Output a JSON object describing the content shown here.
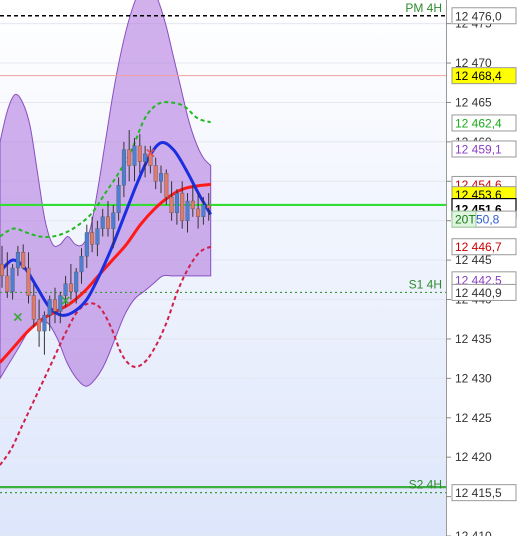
{
  "chart_data": {
    "type": "candlestick",
    "title": "",
    "instrument_timeframe": "",
    "ylim": [
      12410,
      12478
    ],
    "y_ticks": [
      12410,
      12415,
      12420,
      12425,
      12430,
      12435,
      12440,
      12445,
      12450,
      12455,
      12460,
      12465,
      12470,
      12475
    ],
    "y_tick_labels": [
      "12 410",
      "12 415",
      "12 420",
      "12 425",
      "12 430",
      "12 435",
      "12 440",
      "12 445",
      "12 450",
      "12 455",
      "12 460",
      "12 465",
      "12 470",
      "12 475"
    ],
    "candles": [
      {
        "o": 12444.5,
        "h": 12446.8,
        "l": 12441.5,
        "c": 12443.0
      },
      {
        "o": 12443.0,
        "h": 12446.0,
        "l": 12440.2,
        "c": 12441.0
      },
      {
        "o": 12441.0,
        "h": 12444.5,
        "l": 12440.0,
        "c": 12444.0
      },
      {
        "o": 12444.0,
        "h": 12446.8,
        "l": 12443.0,
        "c": 12446.0
      },
      {
        "o": 12446.0,
        "h": 12447.0,
        "l": 12443.8,
        "c": 12444.0
      },
      {
        "o": 12444.0,
        "h": 12446.0,
        "l": 12439.5,
        "c": 12440.5
      },
      {
        "o": 12440.5,
        "h": 12442.0,
        "l": 12436.5,
        "c": 12437.5
      },
      {
        "o": 12437.5,
        "h": 12440.0,
        "l": 12434.0,
        "c": 12436.0
      },
      {
        "o": 12436.0,
        "h": 12438.5,
        "l": 12433.0,
        "c": 12438.0
      },
      {
        "o": 12438.0,
        "h": 12440.5,
        "l": 12436.0,
        "c": 12440.0
      },
      {
        "o": 12440.0,
        "h": 12441.5,
        "l": 12437.0,
        "c": 12438.5
      },
      {
        "o": 12438.5,
        "h": 12441.0,
        "l": 12437.0,
        "c": 12440.5
      },
      {
        "o": 12440.5,
        "h": 12443.0,
        "l": 12439.0,
        "c": 12442.0
      },
      {
        "o": 12442.0,
        "h": 12444.5,
        "l": 12440.0,
        "c": 12441.0
      },
      {
        "o": 12441.0,
        "h": 12444.0,
        "l": 12439.5,
        "c": 12443.5
      },
      {
        "o": 12443.5,
        "h": 12446.5,
        "l": 12442.0,
        "c": 12445.5
      },
      {
        "o": 12445.5,
        "h": 12449.5,
        "l": 12444.0,
        "c": 12448.5
      },
      {
        "o": 12448.5,
        "h": 12450.5,
        "l": 12446.0,
        "c": 12447.0
      },
      {
        "o": 12447.0,
        "h": 12450.0,
        "l": 12445.5,
        "c": 12449.0
      },
      {
        "o": 12449.0,
        "h": 12451.5,
        "l": 12448.0,
        "c": 12450.5
      },
      {
        "o": 12450.5,
        "h": 12452.5,
        "l": 12448.0,
        "c": 12449.0
      },
      {
        "o": 12449.0,
        "h": 12452.0,
        "l": 12446.5,
        "c": 12451.0
      },
      {
        "o": 12451.0,
        "h": 12455.5,
        "l": 12450.0,
        "c": 12454.5
      },
      {
        "o": 12454.5,
        "h": 12460.0,
        "l": 12453.0,
        "c": 12459.0
      },
      {
        "o": 12459.0,
        "h": 12461.5,
        "l": 12455.0,
        "c": 12457.0
      },
      {
        "o": 12457.0,
        "h": 12460.5,
        "l": 12455.0,
        "c": 12459.5
      },
      {
        "o": 12459.5,
        "h": 12461.0,
        "l": 12456.0,
        "c": 12457.5
      },
      {
        "o": 12457.5,
        "h": 12459.5,
        "l": 12455.5,
        "c": 12458.5
      },
      {
        "o": 12458.5,
        "h": 12459.5,
        "l": 12456.0,
        "c": 12457.0
      },
      {
        "o": 12457.0,
        "h": 12458.0,
        "l": 12454.0,
        "c": 12455.0
      },
      {
        "o": 12455.0,
        "h": 12457.0,
        "l": 12453.5,
        "c": 12456.0
      },
      {
        "o": 12456.0,
        "h": 12456.5,
        "l": 12452.0,
        "c": 12453.0
      },
      {
        "o": 12453.0,
        "h": 12455.0,
        "l": 12450.0,
        "c": 12451.0
      },
      {
        "o": 12451.0,
        "h": 12454.0,
        "l": 12449.5,
        "c": 12453.5
      },
      {
        "o": 12453.5,
        "h": 12455.0,
        "l": 12449.0,
        "c": 12450.0
      },
      {
        "o": 12450.0,
        "h": 12453.5,
        "l": 12448.5,
        "c": 12452.5
      },
      {
        "o": 12452.5,
        "h": 12454.5,
        "l": 12450.5,
        "c": 12451.5
      },
      {
        "o": 12451.5,
        "h": 12453.5,
        "l": 12449.0,
        "c": 12450.5
      },
      {
        "o": 12450.5,
        "h": 12453.0,
        "l": 12449.5,
        "c": 12452.0
      },
      {
        "o": 12452.0,
        "h": 12453.5,
        "l": 12450.0,
        "c": 12451.6
      }
    ],
    "candle_colors": {
      "up": "#4a7fd4",
      "down": "#e07a6a",
      "wick": "#333333"
    },
    "bollinger_fill": "#b57fe0",
    "bollinger_upper": [
      12460,
      12464,
      12466,
      12465,
      12462,
      12456,
      12450,
      12447,
      12447,
      12448,
      12447,
      12447,
      12449,
      12454,
      12460,
      12466,
      12471,
      12475,
      12478,
      12480,
      12480,
      12478,
      12475,
      12471,
      12467,
      12463,
      12460,
      12458,
      12457
    ],
    "bollinger_lower": [
      12430,
      12432,
      12434,
      12436,
      12437,
      12437,
      12435,
      12432,
      12430,
      12429,
      12430,
      12432,
      12435,
      12438,
      12440,
      12441,
      12442,
      12443,
      12443,
      12443,
      12443,
      12443,
      12443
    ],
    "blue_ma": [
      12443.5,
      12445,
      12444,
      12441.5,
      12439,
      12438,
      12438.5,
      12440,
      12443,
      12446.5,
      12450.5,
      12454.5,
      12458,
      12459.9,
      12459,
      12456.5,
      12453.5,
      12450.8
    ],
    "red_ma": [
      12432,
      12434,
      12436,
      12437.5,
      12438.5,
      12439.5,
      12441,
      12443,
      12445,
      12447,
      12449.5,
      12451.5,
      12453,
      12454,
      12454.4,
      12454.6
    ],
    "green_dotted": [
      12448,
      12449,
      12448.5,
      12448,
      12448,
      12448.5,
      12449.5,
      12451,
      12453.5,
      12456,
      12459,
      12463,
      12464.8,
      12465,
      12464.5,
      12463,
      12462.5
    ],
    "red_dotted": [
      12419,
      12421,
      12424,
      12427,
      12430,
      12433,
      12436,
      12438.5,
      12439.5,
      12439,
      12436.5,
      12433,
      12431.5,
      12432,
      12434,
      12437,
      12441,
      12444,
      12446,
      12446.7
    ],
    "price_tags": [
      {
        "label": "12 476,0",
        "value": 12476.0,
        "text_color": "#333333",
        "bg": "#ffffff",
        "border": "#999999"
      },
      {
        "label": "12 468,4",
        "value": 12468.4,
        "text_color": "#000000",
        "bg": "#ffff00",
        "border": "#999999"
      },
      {
        "label": "12 462,4",
        "value": 12462.4,
        "text_color": "#1aab1a",
        "bg": "#ffffff",
        "border": "#999999"
      },
      {
        "label": "12 459,1",
        "value": 12459.1,
        "text_color": "#8a3fc4",
        "bg": "#ffffff",
        "border": "#999999"
      },
      {
        "label": "12 454,6",
        "value": 12454.6,
        "text_color": "#cc0000",
        "bg": "#ffffff",
        "border": "#999999"
      },
      {
        "label": "12 453,6",
        "value": 12453.3,
        "text_color": "#000000",
        "bg": "#ffff00",
        "border": "#999999"
      },
      {
        "label": "12 451,6",
        "value": 12451.6,
        "text_color": "#000000",
        "bg": "#ffffff",
        "border": "#000000",
        "bold": true
      },
      {
        "label": "50,8",
        "value": 12450.2,
        "text_color": "#2a5bd4",
        "bg": "#ffffff",
        "border": "#999999"
      },
      {
        "label": "12 446,7",
        "value": 12446.7,
        "text_color": "#cc0000",
        "bg": "#ffffff",
        "border": "#999999"
      },
      {
        "label": "12 442,5",
        "value": 12442.5,
        "text_color": "#8a3fc4",
        "bg": "#ffffff",
        "border": "#999999"
      },
      {
        "label": "12 440,9",
        "value": 12440.9,
        "text_color": "#333333",
        "bg": "#ffffff",
        "border": "#999999"
      },
      {
        "label": "12 415,5",
        "value": 12415.5,
        "text_color": "#333333",
        "bg": "#ffffff",
        "border": "#999999"
      }
    ],
    "timer_badge": {
      "label": "20T",
      "value": 12450.2,
      "bg": "#dff5df",
      "text_color": "#1a7a1a"
    },
    "levels": [
      {
        "name": "PM 4H",
        "value": 12476.0,
        "color": "#000000",
        "style": "dashed"
      },
      {
        "name": "",
        "value": 12468.4,
        "color": "#f2a0a0",
        "style": "solid"
      },
      {
        "name": "",
        "value": 12452.0,
        "color": "#33dd33",
        "style": "solid"
      },
      {
        "name": "S1 4H",
        "value": 12440.9,
        "color": "#3a9a3a",
        "style": "dotted"
      },
      {
        "name": "",
        "value": 12416.2,
        "color": "#3cb043",
        "style": "solid"
      },
      {
        "name": "S2 4H",
        "value": 12415.5,
        "color": "#3a9a3a",
        "style": "dotted"
      }
    ],
    "markers": [
      {
        "kind": "x",
        "label": "×",
        "value": 12437.7,
        "candle": 3,
        "color": "#3aa83a"
      },
      {
        "kind": "x",
        "label": "×",
        "value": 12439.8,
        "candle": 12,
        "color": "#3aa83a"
      },
      {
        "kind": "x",
        "label": "×",
        "value": 12458.5,
        "candle": 28,
        "color": "#e05050"
      }
    ],
    "grid": true,
    "legend": "none"
  }
}
